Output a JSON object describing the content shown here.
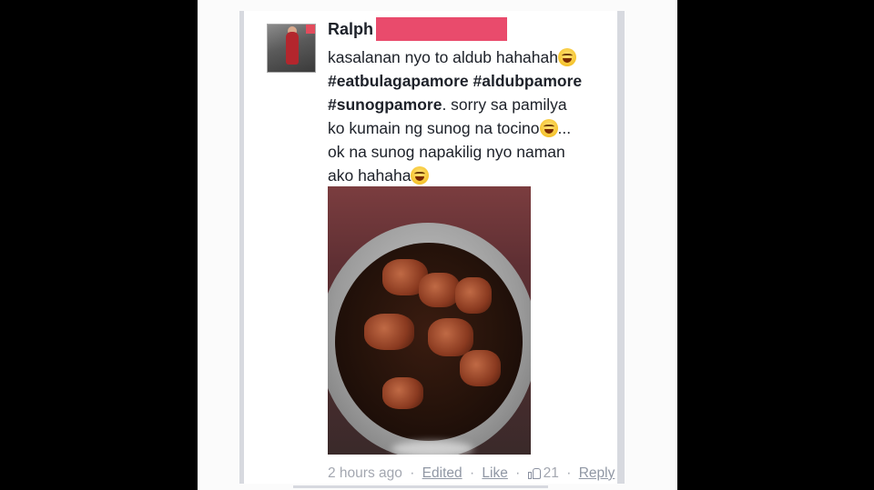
{
  "comment": {
    "author": "Ralph",
    "text": {
      "line1": "kasalanan nyo to aldub hahahah",
      "hashtag1": "#eatbulagapamore",
      "hashtag2": "#aldubpamore",
      "hashtag3": "#sunogpamore",
      "line3_rest": ". sorry sa pamilya",
      "line4": "ko kumain ng sunog na tocino",
      "line4_tail": "...",
      "line5": "ok na sunog napakilig nyo naman",
      "line6": "ako hahaha"
    },
    "emoji_icons": [
      "grinning-squint-emoji",
      "grinning-emoji",
      "grinning-emoji"
    ],
    "photo_icon": "burnt-tocino-photo"
  },
  "footer": {
    "timestamp": "2 hours ago",
    "sep": "·",
    "edited_label": "Edited",
    "like_label": "Like",
    "like_count": "21",
    "reply_label": "Reply",
    "like_icon": "thumbs-up-icon"
  },
  "colors": {
    "background": "#000000",
    "card": "#ffffff",
    "text": "#1d2129",
    "meta": "#a3a7b0",
    "redaction": "#e94b6c"
  }
}
